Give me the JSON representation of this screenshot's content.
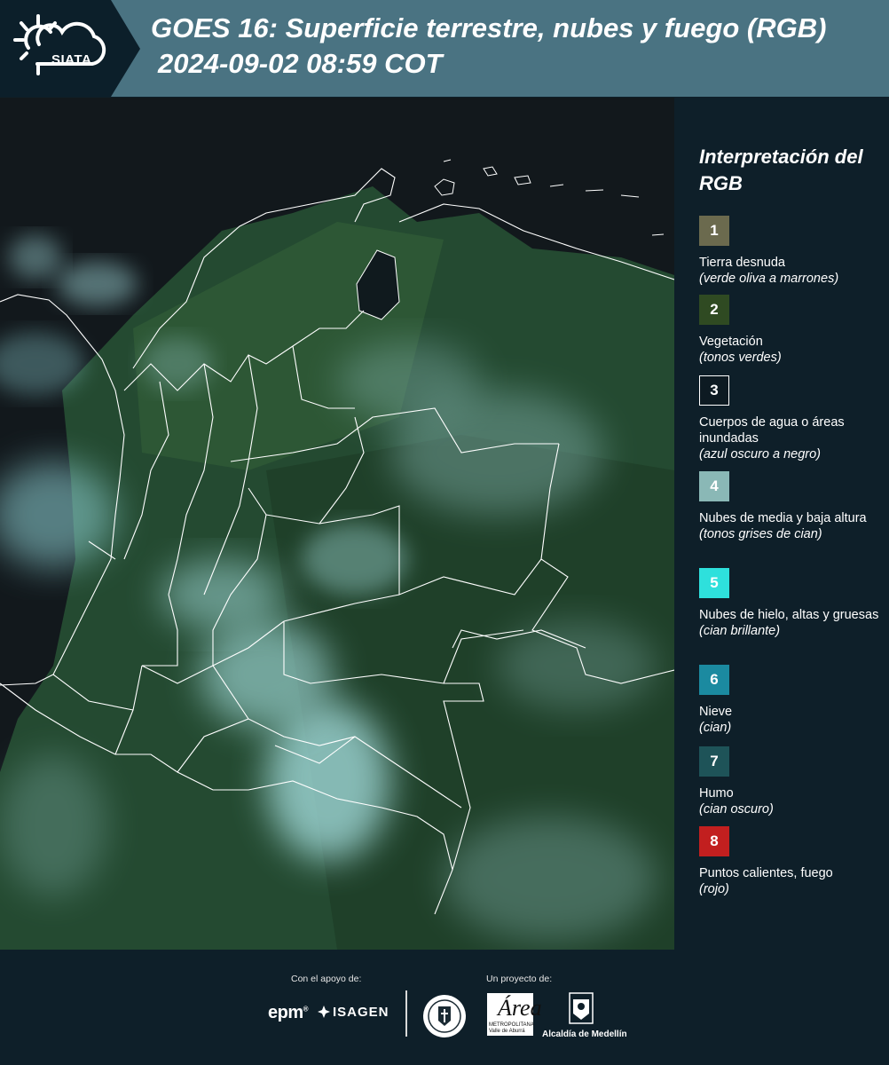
{
  "header": {
    "logo_text": "SIATA",
    "title_line1": "GOES 16: Superficie terrestre, nubes y fuego (RGB)",
    "title_line2": "2024-09-02 08:59 COT"
  },
  "colors": {
    "header_band": "#4a7382",
    "header_dark": "#0c1f2a",
    "background": "#0e1f29",
    "ocean": "#12181c",
    "land": "#244a31",
    "cloud_cyan": "#a8e2e3",
    "border_line": "#ffffff"
  },
  "map": {
    "description_icon": "satellite-rgb-map"
  },
  "legend": {
    "title": "Interpretación del RGB",
    "items": [
      {
        "number": "1",
        "label": "Tierra desnuda",
        "desc": "(verde oliva a marrones)",
        "color": "#6b6a4e",
        "border": "#6b6a4e"
      },
      {
        "number": "2",
        "label": "Vegetación",
        "desc": "(tonos verdes)",
        "color": "#2f4a22",
        "border": "#2f4a22"
      },
      {
        "number": "3",
        "label": "Cuerpos de agua o áreas inundadas",
        "desc": "(azul oscuro a negro)",
        "color": "#0d1a22",
        "border": "#ffffff"
      },
      {
        "number": "4",
        "label": "Nubes de media y baja altura",
        "desc": "(tonos grises de cian)",
        "color": "#8ab8b6",
        "border": "#8ab8b6"
      },
      {
        "number": "5",
        "label": "Nubes de hielo, altas y gruesas",
        "desc": "(cian brillante)",
        "color": "#2ee0dc",
        "border": "#2ee0dc"
      },
      {
        "number": "6",
        "label": "Nieve",
        "desc": "(cian)",
        "color": "#1b8aa0",
        "border": "#1b8aa0"
      },
      {
        "number": "7",
        "label": "Humo",
        "desc": "(cian oscuro)",
        "color": "#1e5358",
        "border": "#1e5358"
      },
      {
        "number": "8",
        "label": "Puntos calientes, fuego",
        "desc": "(rojo)",
        "color": "#c21f1f",
        "border": "#c21f1f"
      }
    ]
  },
  "footer": {
    "support_label": "Con el apoyo de:",
    "project_label": "Un proyecto de:",
    "epm": "epm",
    "epm_mark": "®",
    "isagen": "ISAGEN",
    "amva_letter": "Área",
    "amva_sub1": "METROPOLITANA",
    "amva_sub2": "Valle de Aburrá",
    "medellin": "Alcaldía de Medellín"
  }
}
